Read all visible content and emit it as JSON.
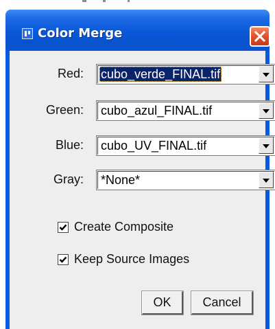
{
  "window": {
    "title": "Color Merge"
  },
  "channels": [
    {
      "label": "Red:",
      "value": "cubo_verde_FINAL.tif",
      "selected": true
    },
    {
      "label": "Green:",
      "value": "cubo_azul_FINAL.tif",
      "selected": false
    },
    {
      "label": "Blue:",
      "value": "cubo_UV_FINAL.tif",
      "selected": false
    },
    {
      "label": "Gray:",
      "value": "*None*",
      "selected": false
    }
  ],
  "options": {
    "create_composite": {
      "label": "Create Composite",
      "checked": true
    },
    "keep_source": {
      "label": "Keep Source Images",
      "checked": true
    }
  },
  "buttons": {
    "ok": "OK",
    "cancel": "Cancel"
  },
  "colors": {
    "titlebar": "#0a58d8",
    "close": "#e3512a",
    "client_bg": "#eeeeee",
    "selection": "#0a246a"
  },
  "icons": {
    "title": "app-icon",
    "close": "close-icon",
    "dropdown": "chevron-down-icon",
    "check": "check-icon"
  }
}
